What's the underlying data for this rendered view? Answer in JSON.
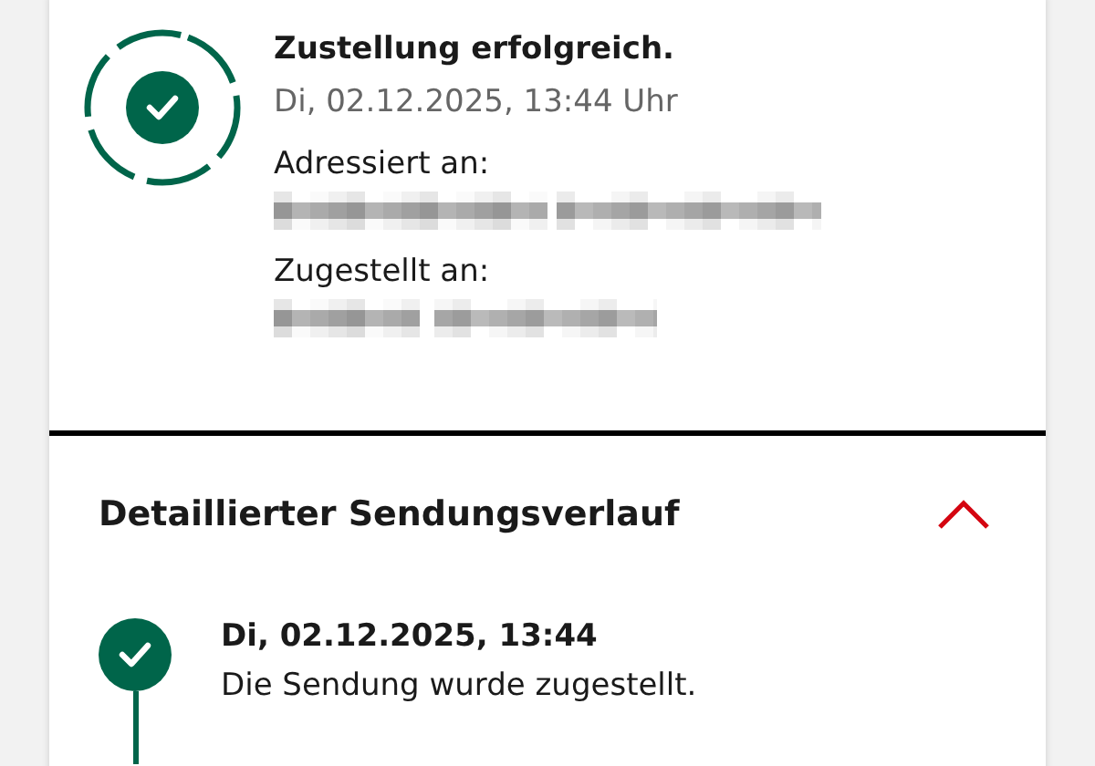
{
  "delivery_status": {
    "title": "Zustellung erfolgreich.",
    "datetime": "Di, 02.12.2025, 13:44 Uhr",
    "completed": true,
    "recipients": [
      {
        "label": "Adressiert an:",
        "redacted": true
      },
      {
        "label": "Zugestellt an:",
        "redacted": true
      }
    ]
  },
  "history": {
    "title": "Detaillierter Sendungsverlauf",
    "expanded": true,
    "events": [
      {
        "datetime": "Di, 02.12.2025, 13:44",
        "description": "Die Sendung wurde zugestellt.",
        "completed": true
      }
    ]
  }
}
